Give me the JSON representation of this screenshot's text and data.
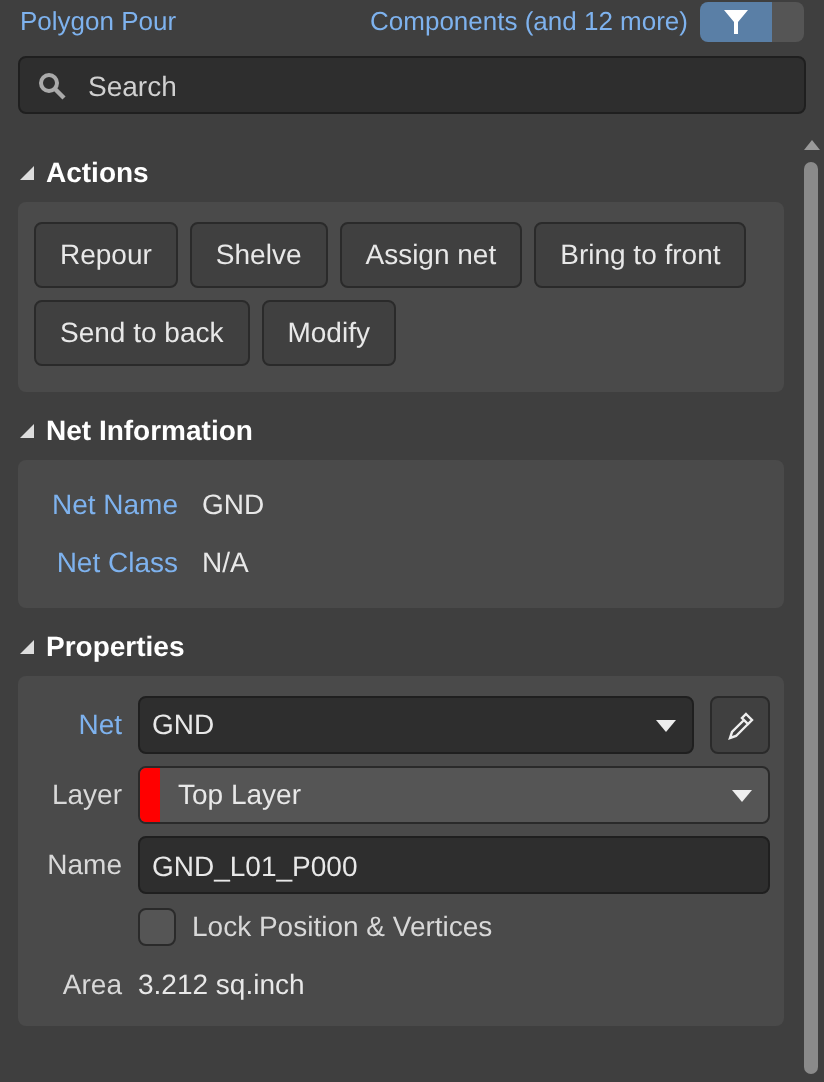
{
  "header": {
    "object_type": "Polygon Pour",
    "filter_label": "Components (and 12 more)"
  },
  "search": {
    "placeholder": "Search"
  },
  "sections": [
    {
      "kind": "buttons",
      "title": "Actions",
      "expanded": true,
      "buttons": [
        "Repour",
        "Shelve",
        "Assign net",
        "Bring to front",
        "Send to back",
        "Modify"
      ]
    },
    {
      "kind": "info",
      "title": "Net Information",
      "expanded": true,
      "rows": [
        {
          "label": "Net Name",
          "value": "GND"
        },
        {
          "label": "Net Class",
          "value": "N/A"
        }
      ]
    },
    {
      "kind": "props",
      "title": "Properties",
      "expanded": true,
      "net": {
        "label": "Net",
        "value": "GND"
      },
      "layer": {
        "label": "Layer",
        "value": "Top Layer",
        "color": "#ff0000"
      },
      "name": {
        "label": "Name",
        "value": "GND_L01_P000"
      },
      "lock": {
        "label": "Lock Position & Vertices",
        "checked": false
      },
      "area": {
        "label": "Area",
        "value": "3.212 sq.inch"
      }
    }
  ]
}
